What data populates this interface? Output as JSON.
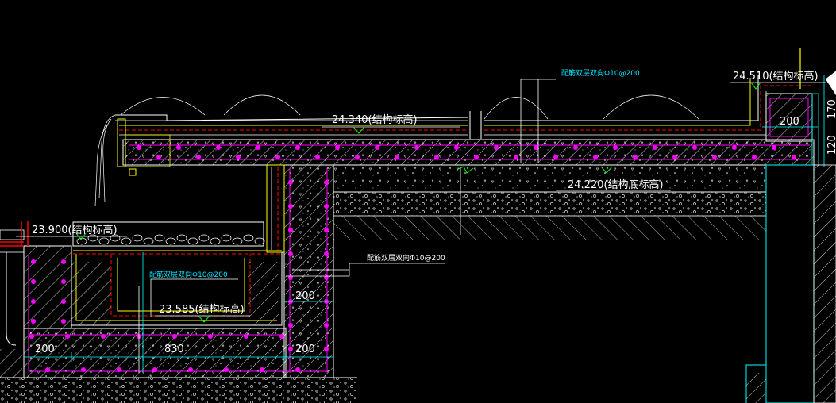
{
  "drawing": {
    "elevations": {
      "roof_top": "24.340(结构标高)",
      "parapet_top": "24.510(结构标高)",
      "slab_bottom": "24.220(结构底标高)",
      "planter_left": "23.900(结构标高)",
      "pit_bottom": "23.585(结构标高)"
    },
    "rebar_notes": {
      "top": "配筋双层双向Φ10@200",
      "pit": "配筋双层双向Φ10@200",
      "wall": "配筋双层双向Φ10@200"
    },
    "dimensions": {
      "left_wall": "200",
      "pit_width": "830",
      "right_wall": "200",
      "wall_height": "200",
      "parapet": "200",
      "side_170": "170",
      "side_120": "120"
    }
  },
  "colors": {
    "background": "#000000",
    "concrete": "#ffffff",
    "rebar": "#ff00ff",
    "membrane": "#ffff00",
    "outline": "#00ffff",
    "waterproof": "#ff0000",
    "leader": "#00ff00"
  }
}
